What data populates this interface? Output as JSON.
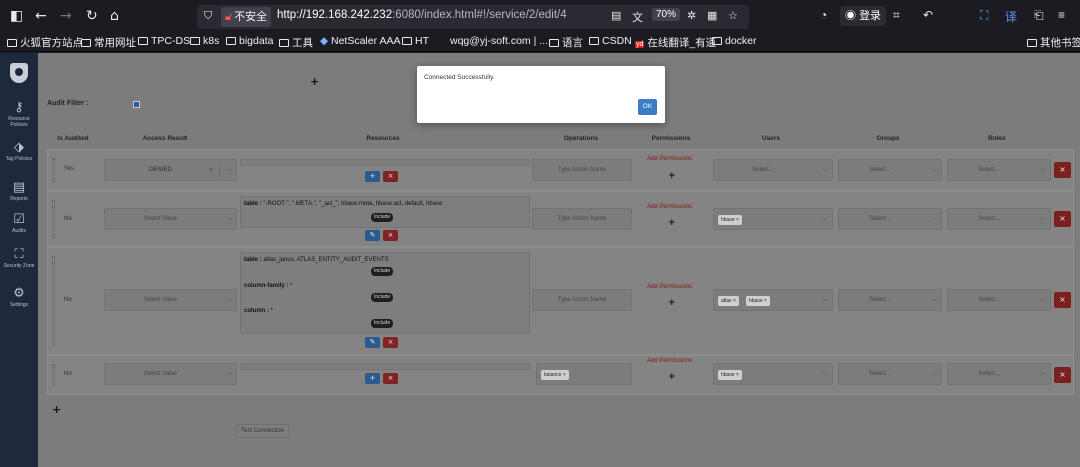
{
  "browser": {
    "url_secure_label": "不安全",
    "url_host": "http://192.168.242.232",
    "url_path": ":6080/index.html#!/service/2/edit/4",
    "zoom": "70%",
    "login_label": "登录"
  },
  "bookmarks": [
    {
      "label": "火狐官方站点"
    },
    {
      "label": "常用网址"
    },
    {
      "label": "TPC-DS"
    },
    {
      "label": "k8s"
    },
    {
      "label": "bigdata"
    },
    {
      "label": "工具"
    },
    {
      "label": "NetScaler AAA"
    },
    {
      "label": "HT"
    },
    {
      "label": "wqg@yj-soft.com | ..."
    },
    {
      "label": "语言"
    },
    {
      "label": "CSDN"
    },
    {
      "label": "在线翻译_有道"
    },
    {
      "label": "docker"
    },
    {
      "label": "其他书签"
    }
  ],
  "sidebar": {
    "items": [
      {
        "icon": "key-icon",
        "label": "Resource Policies"
      },
      {
        "icon": "tag-icon",
        "label": "Tag Policies"
      },
      {
        "icon": "report-icon",
        "label": "Reports"
      },
      {
        "icon": "audit-icon",
        "label": "Audits"
      },
      {
        "icon": "security-zone-icon",
        "label": "Security Zone"
      },
      {
        "icon": "settings-icon",
        "label": "Settings"
      }
    ]
  },
  "form": {
    "plus_label": "+",
    "audit_filter_label": "Audit Filter :",
    "audit_filter_checked": true,
    "columns": [
      "Is Audited",
      "Access Result",
      "Resources",
      "Operations",
      "Permissions",
      "Users",
      "Groups",
      "Roles"
    ],
    "add_permissions_label": "Add Permissions",
    "action_placeholder": "Type Action Name",
    "select_value_placeholder": "Select Value",
    "select_placeholder": "Select...",
    "include_label": "Include",
    "rows": [
      {
        "is_audited": "Yes",
        "access_result": "DENIED",
        "resources": [],
        "operations": [],
        "users": [],
        "groups": [],
        "roles": []
      },
      {
        "is_audited": "No",
        "access_result": "",
        "resources": [
          {
            "label": "table :",
            "value": "\"-ROOT-\", \".META.\", \"_acl_\", hbase:meta, hbase:acl, default, hbase",
            "mode": "Include"
          }
        ],
        "operations": [],
        "users": [
          "hbase"
        ],
        "groups": [],
        "roles": []
      },
      {
        "is_audited": "No",
        "access_result": "",
        "resources": [
          {
            "label": "table :",
            "value": "atlas_janus, ATLAS_ENTITY_AUDIT_EVENTS",
            "mode": "Include"
          },
          {
            "label": "column-family :",
            "value": "*",
            "mode": "Include"
          },
          {
            "label": "column :",
            "value": "*",
            "mode": "Include"
          }
        ],
        "operations": [],
        "users": [
          "atlas",
          "hbase"
        ],
        "groups": [],
        "roles": []
      },
      {
        "is_audited": "No",
        "access_result": "",
        "resources": [],
        "operations": [
          "balance"
        ],
        "users": [
          "hbase"
        ],
        "groups": [],
        "roles": []
      }
    ],
    "test_connection_label": "Test Connection"
  },
  "modal": {
    "message": "Connected Successfully.",
    "ok_label": "OK"
  }
}
